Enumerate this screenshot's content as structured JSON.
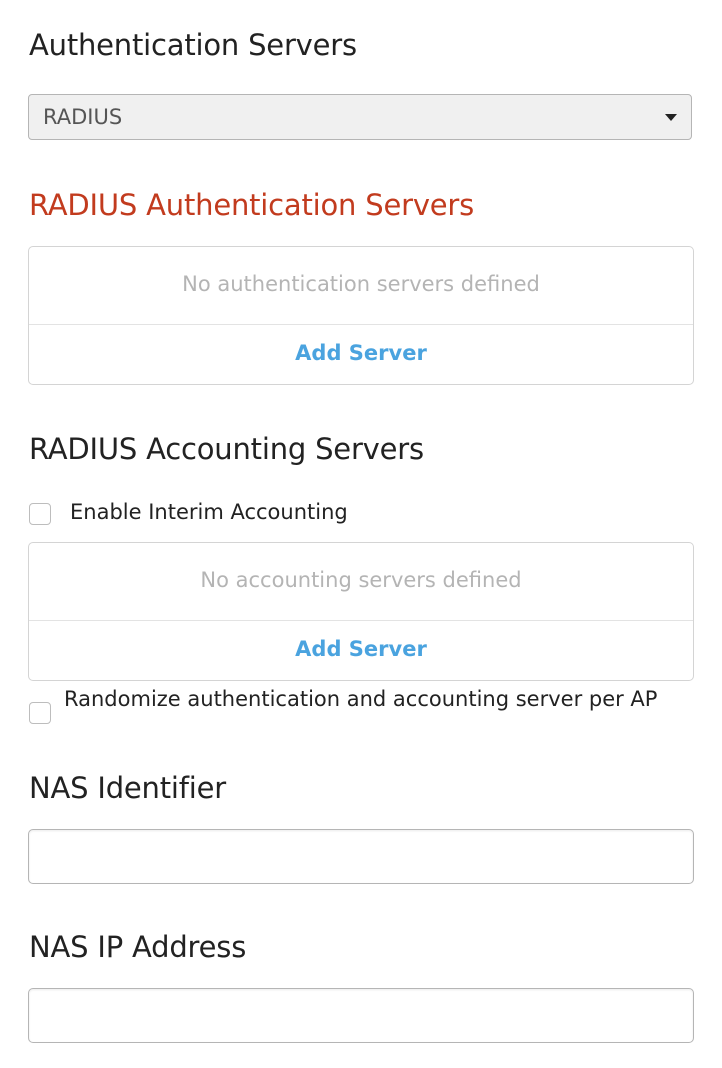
{
  "auth_servers": {
    "title": "Authentication Servers",
    "selected_type": "RADIUS"
  },
  "radius_auth": {
    "title": "RADIUS Authentication Servers",
    "title_color": "#c23b1e",
    "empty_message": "No authentication servers defined",
    "add_label": "Add Server"
  },
  "radius_accounting": {
    "title": "RADIUS Accounting Servers",
    "interim_label": "Enable Interim Accounting",
    "interim_checked": false,
    "empty_message": "No accounting servers defined",
    "add_label": "Add Server"
  },
  "randomize": {
    "label": "Randomize authentication and accounting server per AP",
    "checked": false
  },
  "nas_identifier": {
    "label": "NAS Identifier",
    "value": ""
  },
  "nas_ip": {
    "label": "NAS IP Address",
    "value": ""
  },
  "colors": {
    "link": "#4aa3df",
    "error_heading": "#c23b1e",
    "muted_text": "#b4b4b4"
  }
}
